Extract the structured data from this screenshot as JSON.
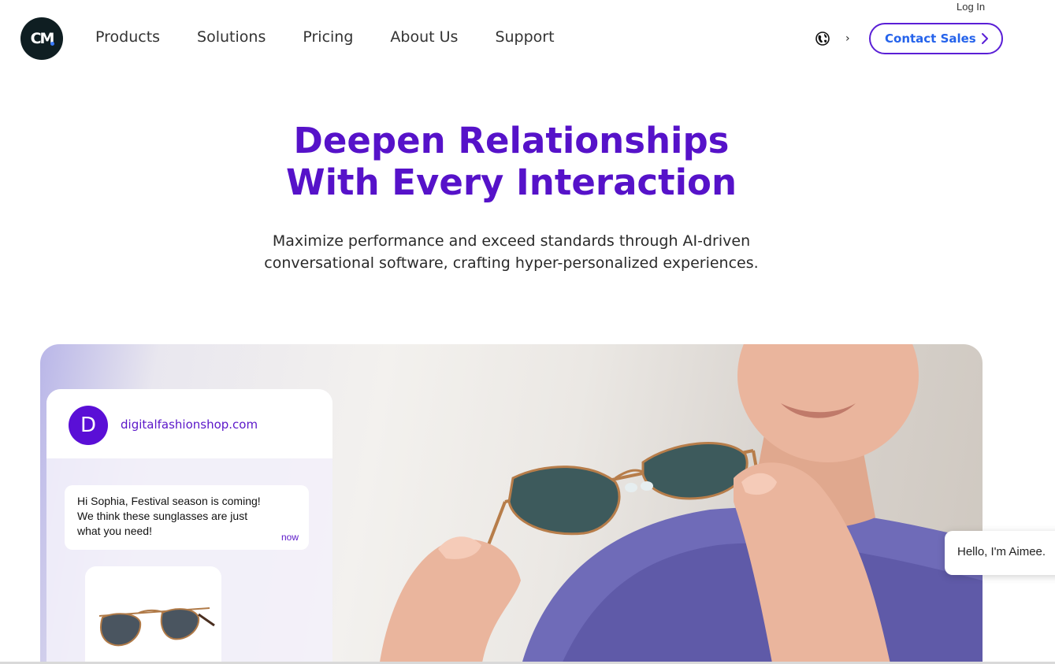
{
  "header": {
    "login_label": "Log In",
    "logo_text": "CM",
    "nav": [
      "Products",
      "Solutions",
      "Pricing",
      "About Us",
      "Support"
    ],
    "contact_label": "Contact Sales"
  },
  "hero": {
    "title_line1": "Deepen Relationships",
    "title_line2": "With Every Interaction",
    "subtitle_line1": "Maximize performance and exceed standards through AI-driven",
    "subtitle_line2": "conversational software, crafting hyper-personalized experiences."
  },
  "chat": {
    "avatar_letter": "D",
    "domain": "digitalfashionshop.com",
    "message_line1": "Hi Sophia, Festival season is coming!",
    "message_line2": "We think these sunglasses are just",
    "message_line3": "what you need!",
    "time": "now"
  },
  "assistant": {
    "greeting": "Hello, I'm Aimee."
  },
  "colors": {
    "brand_purple": "#5612c9",
    "link_blue": "#2563eb",
    "logo_dark": "#0f1e22"
  },
  "icons": [
    "globe-icon",
    "chevron-right-icon",
    "logo-icon"
  ]
}
